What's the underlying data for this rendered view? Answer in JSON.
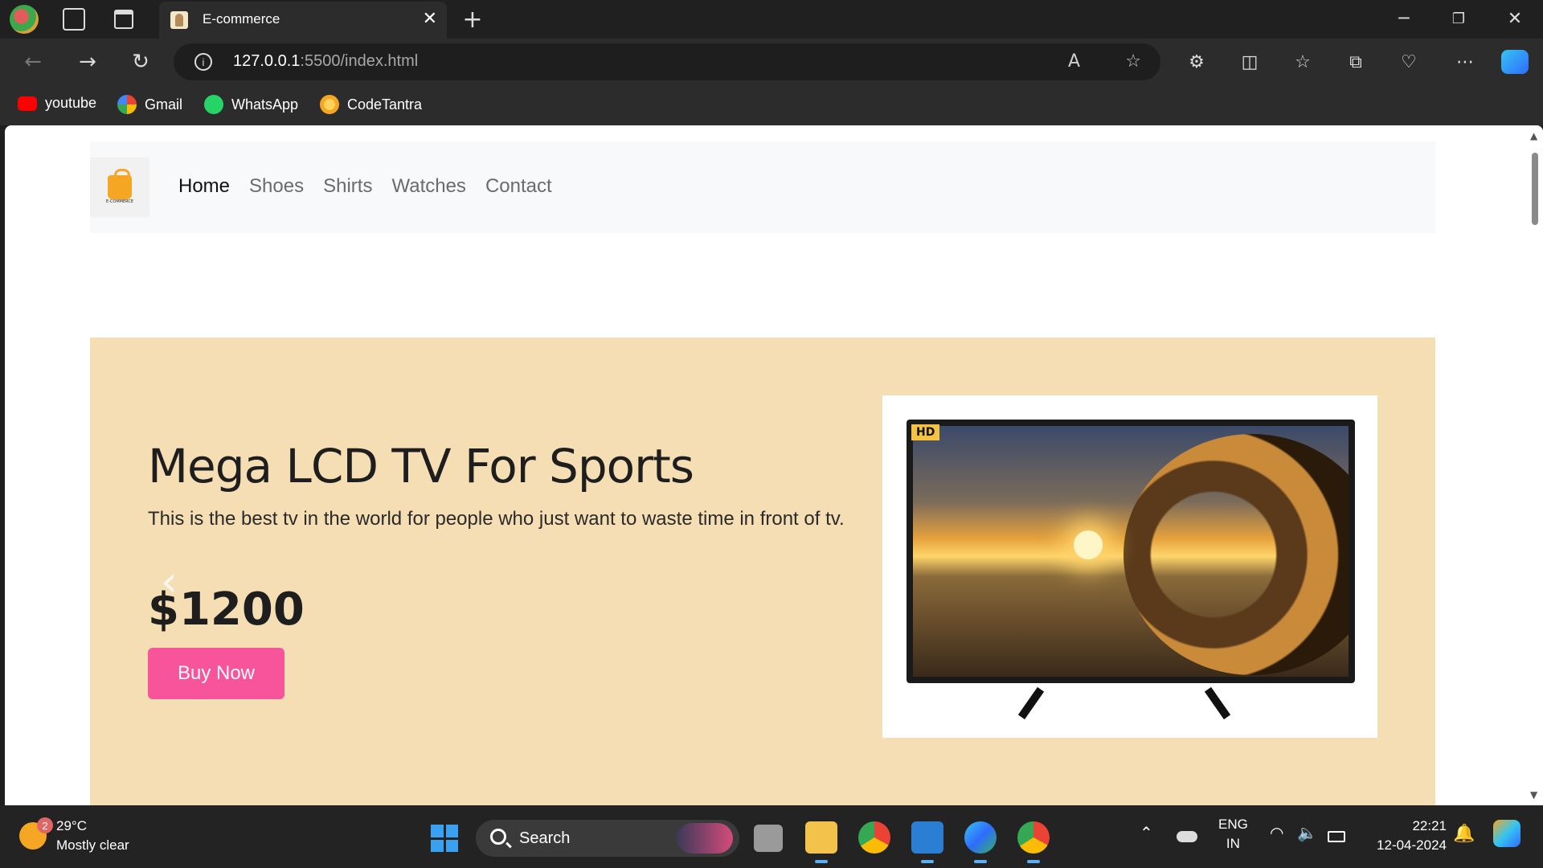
{
  "browser": {
    "tab": {
      "title": "E-commerce"
    },
    "address": {
      "host": "127.0.0.1",
      "path": ":5500/index.html"
    },
    "bookmarks": [
      {
        "label": "youtube",
        "icon": "youtube-icon",
        "color": "#ff0000"
      },
      {
        "label": "Gmail",
        "icon": "google-icon",
        "color": "#ffffff"
      },
      {
        "label": "WhatsApp",
        "icon": "whatsapp-icon",
        "color": "#25d366"
      },
      {
        "label": "CodeTantra",
        "icon": "codetantra-icon",
        "color": "#f5a623"
      }
    ]
  },
  "page": {
    "logo_text": "E-COMMERCE",
    "nav": [
      {
        "label": "Home",
        "active": true
      },
      {
        "label": "Shoes",
        "active": false
      },
      {
        "label": "Shirts",
        "active": false
      },
      {
        "label": "Watches",
        "active": false
      },
      {
        "label": "Contact",
        "active": false
      }
    ],
    "hero": {
      "title": "Mega LCD TV For Sports",
      "description": "This is the best tv in the world for people who just want to waste time in front of tv.",
      "price": "$1200",
      "button": "Buy Now",
      "badge": "HD",
      "background": "#f5deb3",
      "button_color": "#f7549b"
    }
  },
  "taskbar": {
    "weather": {
      "temp": "29°C",
      "condition": "Mostly clear",
      "badge": "2"
    },
    "search": "Search",
    "lang": {
      "line1": "ENG",
      "line2": "IN"
    },
    "clock": {
      "time": "22:21",
      "date": "12-04-2024"
    }
  }
}
